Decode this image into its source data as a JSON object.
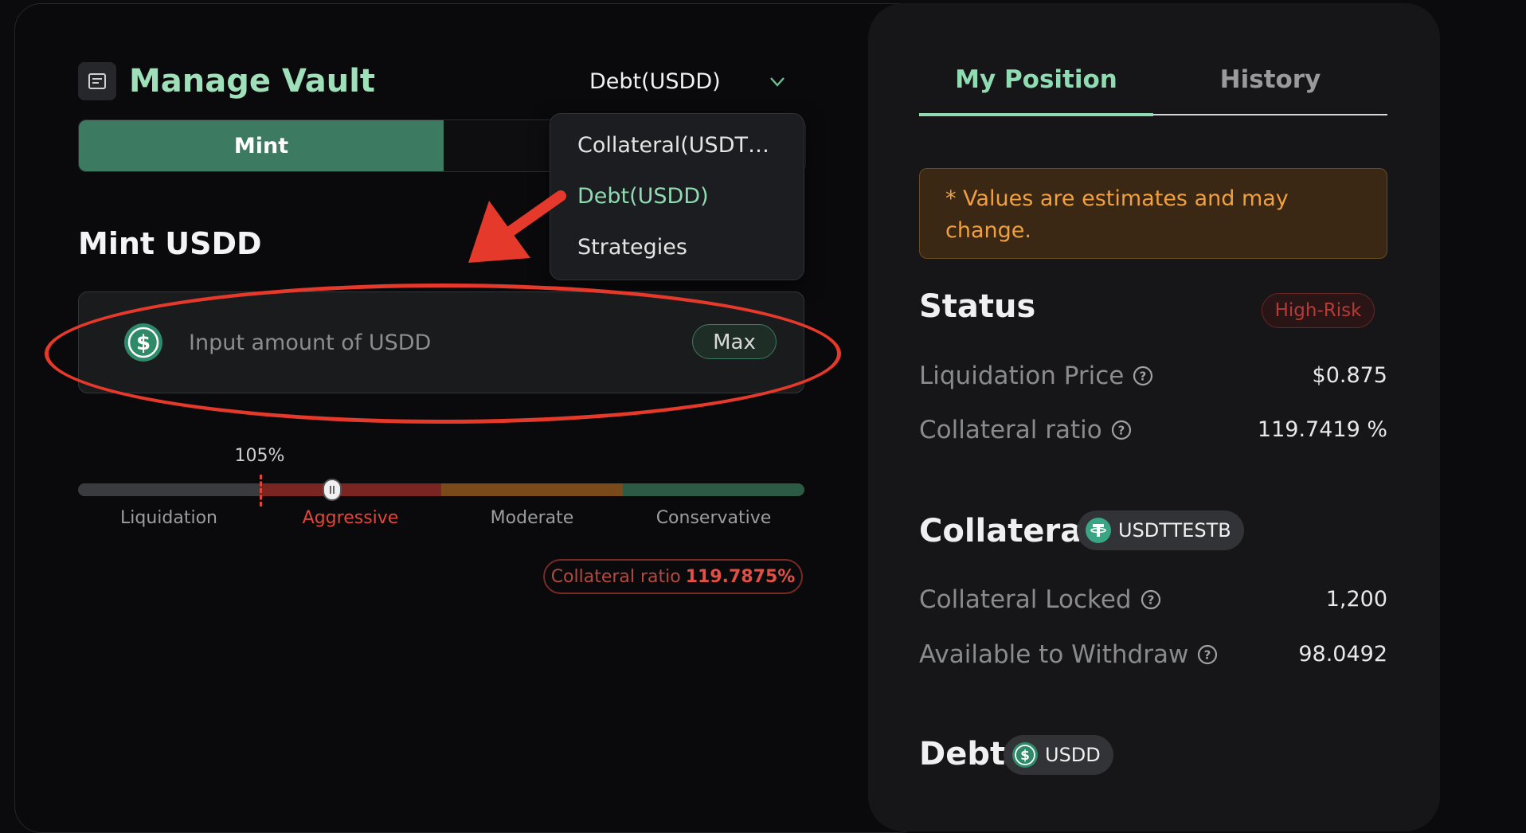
{
  "header": {
    "title": "Manage Vault",
    "dropdown_selected": "Debt(USDD)",
    "icons": {
      "vault": "vault-icon",
      "chevron": "chevron-down-icon"
    }
  },
  "mode_tabs": {
    "mint_label": "Mint",
    "second_label": ""
  },
  "dropdown_menu": {
    "items": [
      "Collateral(USDT…",
      "Debt(USDD)",
      "Strategies"
    ],
    "active_index": 1
  },
  "mint_section": {
    "title": "Mint USDD",
    "input_placeholder": "Input amount of USDD",
    "input_value": "",
    "max_label": "Max",
    "token_icon": "usdd-token-icon"
  },
  "slider": {
    "marker_label": "105%",
    "zones": [
      "Liquidation",
      "Aggressive",
      "Moderate",
      "Conservative"
    ],
    "active_zone": "Aggressive",
    "colors": {
      "liquidation": "#3a3b3e",
      "aggressive": "#7a2522",
      "moderate": "#7a4a1a",
      "conservative": "#2c5a45"
    }
  },
  "ratio_badge": {
    "label": "Collateral ratio",
    "value": "119.7875%"
  },
  "right_panel": {
    "tabs": [
      "My Position",
      "History"
    ],
    "active_tab": "My Position",
    "notice": "* Values are estimates and may change.",
    "status": {
      "heading": "Status",
      "badge": "High-Risk",
      "rows": [
        {
          "label": "Liquidation Price",
          "value": "$0.875"
        },
        {
          "label": "Collateral ratio",
          "value": "119.7419 %"
        }
      ]
    },
    "collateral": {
      "heading": "Collateral",
      "token": "USDTTESTB",
      "rows": [
        {
          "label": "Collateral Locked",
          "value": "1,200"
        },
        {
          "label": "Available to Withdraw",
          "value": "98.0492"
        }
      ]
    },
    "debt": {
      "heading": "Debt",
      "token": "USDD"
    }
  },
  "colors": {
    "accent": "#8fdcb2",
    "mint_button": "#3c7a62",
    "warning": "#f0a040",
    "danger": "#e0473a",
    "annotation": "#e4392b"
  }
}
